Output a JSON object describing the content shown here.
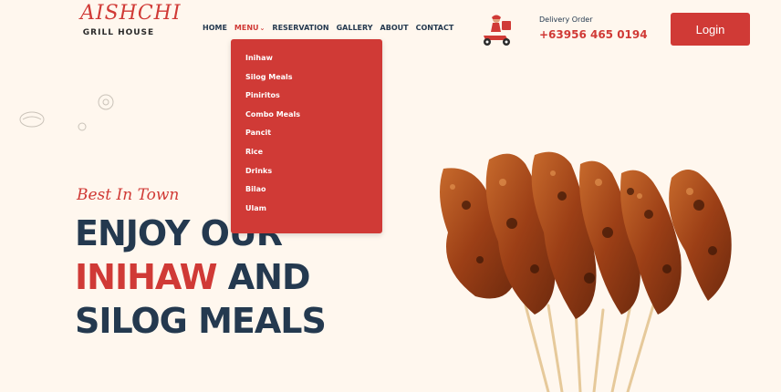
{
  "logo": {
    "brand": "AISHCHI",
    "subtitle": "GRILL HOUSE"
  },
  "nav": {
    "home": "HOME",
    "menu": "MENU",
    "reservation": "RESERVATION",
    "gallery": "GALLERY",
    "about": "ABOUT",
    "contact": "CONTACT"
  },
  "dropdown": {
    "items": [
      "Inihaw",
      "Silog Meals",
      "Piniritos",
      "Combo Meals",
      "Pancit",
      "Rice",
      "Drinks",
      "Bilao",
      "Ulam"
    ]
  },
  "delivery": {
    "label": "Delivery Order",
    "phone": "+63956 465 0194"
  },
  "login": {
    "label": "Login"
  },
  "hero": {
    "tagline": "Best In Town",
    "line1": "ENJOY OUR",
    "line2_red": "INIHAW",
    "line2_rest": " AND",
    "line3": "SILOG MEALS"
  },
  "colors": {
    "accent": "#d03a36",
    "navy": "#24394f",
    "background": "#fff7ee"
  },
  "icons": {
    "delivery": "delivery-scooter-icon",
    "menu_chevron": "chevron-down-icon"
  }
}
